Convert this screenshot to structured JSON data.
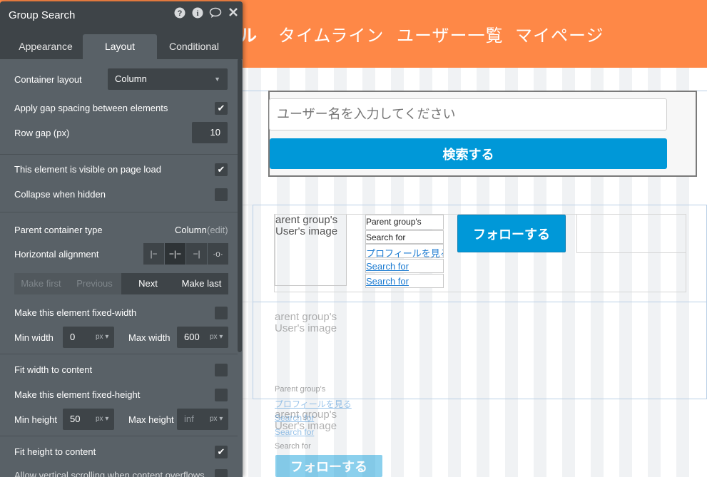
{
  "panel": {
    "title": "Group Search",
    "icons": [
      "help-icon",
      "info-icon",
      "comment-icon",
      "close-icon"
    ],
    "tabs": [
      "Appearance",
      "Layout",
      "Conditional"
    ],
    "active_tab": "Layout",
    "container_layout_label": "Container layout",
    "container_layout_value": "Column",
    "gap_label": "Apply gap spacing between elements",
    "gap_checked": true,
    "row_gap_label": "Row gap (px)",
    "row_gap_value": "10",
    "visible_label": "This element is visible on page load",
    "visible_checked": true,
    "collapse_label": "Collapse when hidden",
    "collapse_checked": false,
    "parent_type_label": "Parent container type",
    "parent_type_value": "Column",
    "parent_type_edit": "(edit)",
    "halign_label": "Horizontal alignment",
    "halign_icons": [
      "align-left-icon",
      "align-center-icon",
      "align-right-icon",
      "align-distribute-icon"
    ],
    "order_buttons": [
      "Make first",
      "Previous",
      "Next",
      "Make last"
    ],
    "fixed_width_label": "Make this element fixed-width",
    "min_width_label": "Min width",
    "min_width_value": "0",
    "max_width_label": "Max width",
    "max_width_value": "600",
    "unit": "px",
    "fit_width_label": "Fit width to content",
    "fixed_height_label": "Make this element fixed-height",
    "min_height_label": "Min height",
    "min_height_value": "50",
    "max_height_label": "Max height",
    "max_height_value": "inf",
    "fit_height_label": "Fit height to content",
    "fit_height_checked": true,
    "bottom_partial_label": "Allow vertical scrolling when content overflows"
  },
  "canvas": {
    "nav_partial": "ル",
    "nav": [
      "タイムライン",
      "ユーザー一覧",
      "マイページ"
    ],
    "search_placeholder": "ユーザー名を入力してください",
    "search_button": "検索する",
    "image_text": "arent group's User's image",
    "image_text_2": "arent group's User's image",
    "image_text_3": "arent group's User's image",
    "parent_group": "Parent group's",
    "search_for": "Search for",
    "profile_link": "プロフィールを見る",
    "search_for_link": "Search for",
    "follow_button": "フォローする",
    "colors": {
      "topbar": "#fe8847",
      "button": "#0098d8",
      "panel": "#596167"
    }
  }
}
